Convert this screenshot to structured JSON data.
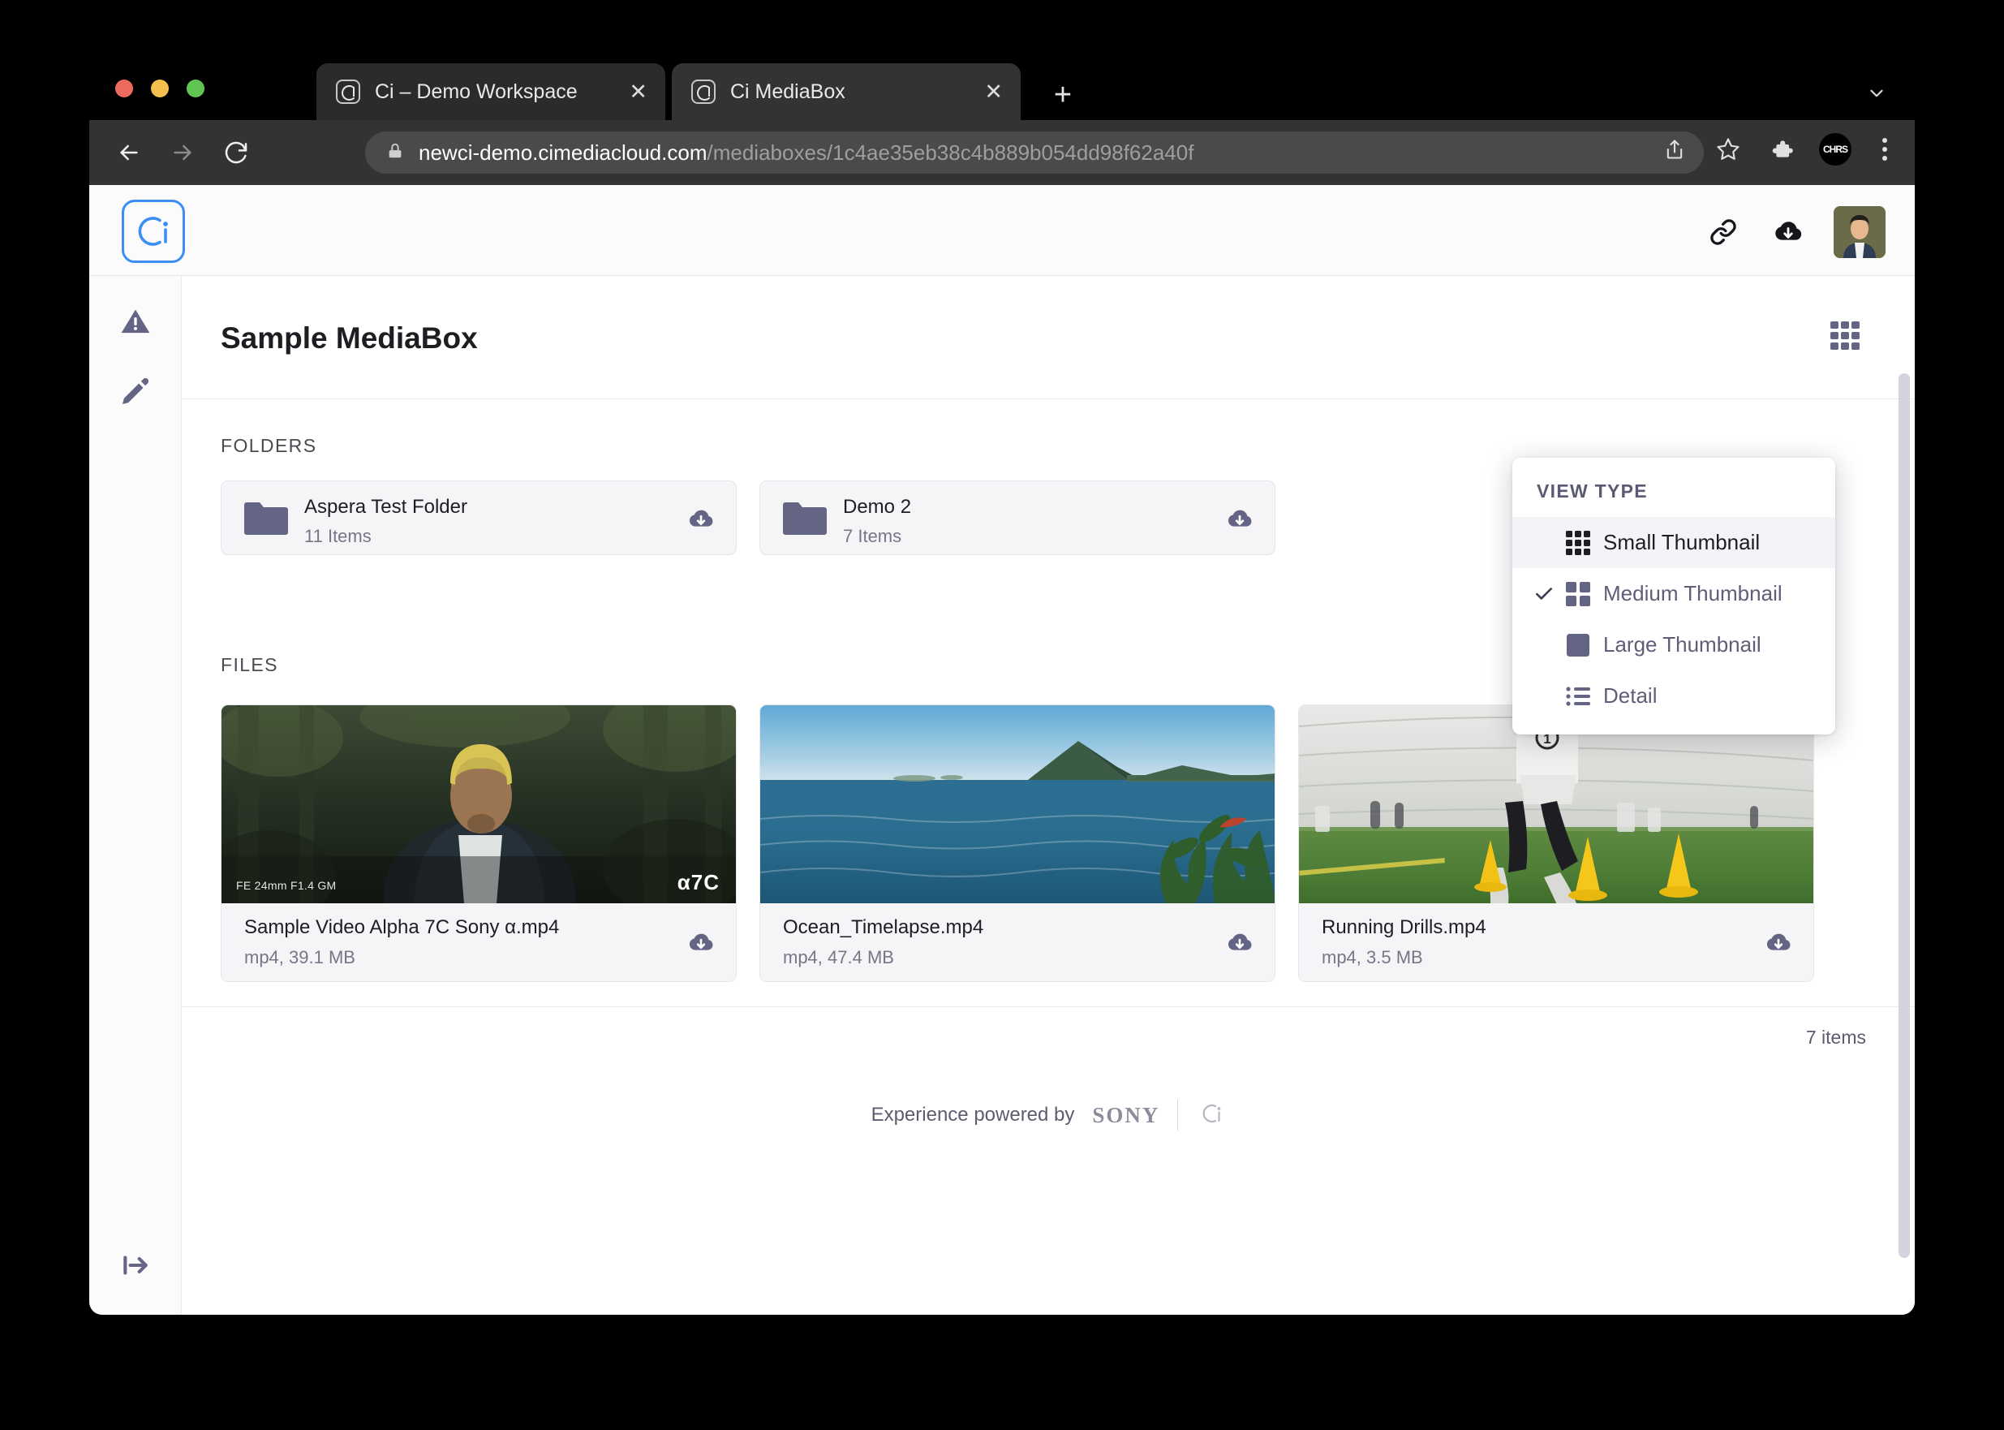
{
  "browser": {
    "tabs": [
      {
        "title": "Ci – Demo Workspace",
        "close": "✕",
        "active": false
      },
      {
        "title": "Ci MediaBox",
        "close": "✕",
        "active": true
      }
    ],
    "new_tab_label": "+",
    "address": {
      "host": "newci-demo.cimediacloud.com",
      "path": "/mediaboxes/1c4ae35eb38c4b889b054dd98f62a40f"
    },
    "profile_badge": "CHRS",
    "icons": {
      "back": "back-arrow-icon",
      "forward": "forward-arrow-icon",
      "reload": "reload-icon",
      "lock": "lock-icon",
      "share": "share-icon",
      "bookmark": "star-icon",
      "extensions": "puzzle-icon",
      "menu": "three-dot-menu-icon",
      "tabstrip_chevron": "chevron-down-icon"
    }
  },
  "app": {
    "logo": "ci-logo",
    "header_icons": {
      "link": "link-icon",
      "download": "download-cloud-icon",
      "avatar": "avatar"
    },
    "sidebar": [
      {
        "name": "warning-icon"
      },
      {
        "name": "edit-pencil-icon"
      },
      {
        "name": "expand-sidebar-icon"
      }
    ],
    "title": "Sample MediaBox",
    "view_type_button_icon": "grid-view-icon",
    "sections": {
      "folders_label": "FOLDERS",
      "files_label": "FILES"
    },
    "folders": [
      {
        "name": "Aspera Test Folder",
        "count": "11 Items"
      },
      {
        "name": "Demo 2",
        "count": "7 Items"
      }
    ],
    "files": [
      {
        "name": "Sample Video Alpha 7C Sony α.mp4",
        "meta": "mp4, 39.1 MB",
        "badge_left": "FE 24mm F1.4 GM",
        "badge_right": "α7C"
      },
      {
        "name": "Ocean_Timelapse.mp4",
        "meta": "mp4, 47.4 MB",
        "badge_left": "",
        "badge_right": ""
      },
      {
        "name": "Running Drills.mp4",
        "meta": "mp4, 3.5 MB",
        "badge_left": "",
        "badge_right": ""
      }
    ],
    "item_count": "7 items",
    "footer": {
      "text": "Experience powered by",
      "brand": "SONY",
      "logo": "ci-logo-small"
    }
  },
  "view_type_menu": {
    "heading": "VIEW TYPE",
    "items": [
      {
        "label": "Small Thumbnail",
        "icon": "small-grid-icon",
        "checked": false,
        "hovered": true
      },
      {
        "label": "Medium Thumbnail",
        "icon": "medium-grid-icon",
        "checked": true,
        "hovered": false
      },
      {
        "label": "Large Thumbnail",
        "icon": "large-square-icon",
        "checked": false,
        "hovered": false
      },
      {
        "label": "Detail",
        "icon": "list-icon",
        "checked": false,
        "hovered": false
      }
    ],
    "check_glyph": "✓"
  },
  "colors": {
    "accent_blue": "#3b8ef3",
    "purple_gray": "#646484",
    "card_bg": "#f5f5f8",
    "toolbar_bg": "#333333",
    "tabstrip_bg": "#000000"
  }
}
